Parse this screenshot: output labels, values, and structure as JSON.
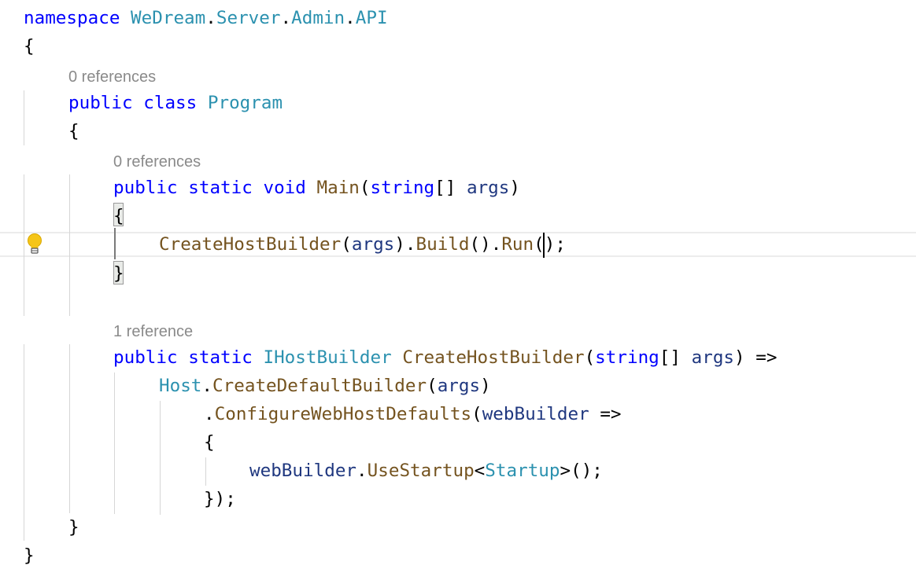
{
  "editor": {
    "code_lens": [
      "0 references",
      "0 references",
      "1 reference"
    ],
    "lines": [
      [
        {
          "t": "namespace",
          "c": "kw"
        },
        {
          "t": " ",
          "c": "pn"
        },
        {
          "t": "WeDream",
          "c": "ty"
        },
        {
          "t": ".",
          "c": "pn"
        },
        {
          "t": "Server",
          "c": "ty"
        },
        {
          "t": ".",
          "c": "pn"
        },
        {
          "t": "Admin",
          "c": "ty"
        },
        {
          "t": ".",
          "c": "pn"
        },
        {
          "t": "API",
          "c": "ty"
        }
      ],
      [
        {
          "t": "{",
          "c": "pn"
        }
      ],
      [
        {
          "t": "public",
          "c": "kw"
        },
        {
          "t": " ",
          "c": "pn"
        },
        {
          "t": "class",
          "c": "kw"
        },
        {
          "t": " ",
          "c": "pn"
        },
        {
          "t": "Program",
          "c": "ty"
        }
      ],
      [
        {
          "t": "{",
          "c": "pn"
        }
      ],
      [
        {
          "t": "public",
          "c": "kw"
        },
        {
          "t": " ",
          "c": "pn"
        },
        {
          "t": "static",
          "c": "kw"
        },
        {
          "t": " ",
          "c": "pn"
        },
        {
          "t": "void",
          "c": "kw"
        },
        {
          "t": " ",
          "c": "pn"
        },
        {
          "t": "Main",
          "c": "mt"
        },
        {
          "t": "(",
          "c": "pn"
        },
        {
          "t": "string",
          "c": "kw"
        },
        {
          "t": "[] ",
          "c": "pn"
        },
        {
          "t": "args",
          "c": "vr"
        },
        {
          "t": ")",
          "c": "pn"
        }
      ],
      [
        {
          "t": "{",
          "c": "pn"
        }
      ],
      [
        {
          "t": "CreateHostBuilder",
          "c": "mt"
        },
        {
          "t": "(",
          "c": "pn"
        },
        {
          "t": "args",
          "c": "vr"
        },
        {
          "t": ").",
          "c": "pn"
        },
        {
          "t": "Build",
          "c": "mt"
        },
        {
          "t": "().",
          "c": "pn"
        },
        {
          "t": "Run",
          "c": "mt"
        },
        {
          "t": "();",
          "c": "pn"
        }
      ],
      [
        {
          "t": "}",
          "c": "pn"
        }
      ],
      [
        {
          "t": "public",
          "c": "kw"
        },
        {
          "t": " ",
          "c": "pn"
        },
        {
          "t": "static",
          "c": "kw"
        },
        {
          "t": " ",
          "c": "pn"
        },
        {
          "t": "IHostBuilder",
          "c": "ty"
        },
        {
          "t": " ",
          "c": "pn"
        },
        {
          "t": "CreateHostBuilder",
          "c": "mt"
        },
        {
          "t": "(",
          "c": "pn"
        },
        {
          "t": "string",
          "c": "kw"
        },
        {
          "t": "[] ",
          "c": "pn"
        },
        {
          "t": "args",
          "c": "vr"
        },
        {
          "t": ") =>",
          "c": "pn"
        }
      ],
      [
        {
          "t": "Host",
          "c": "ty"
        },
        {
          "t": ".",
          "c": "pn"
        },
        {
          "t": "CreateDefaultBuilder",
          "c": "mt"
        },
        {
          "t": "(",
          "c": "pn"
        },
        {
          "t": "args",
          "c": "vr"
        },
        {
          "t": ")",
          "c": "pn"
        }
      ],
      [
        {
          "t": ".",
          "c": "pn"
        },
        {
          "t": "ConfigureWebHostDefaults",
          "c": "mt"
        },
        {
          "t": "(",
          "c": "pn"
        },
        {
          "t": "webBuilder",
          "c": "vr"
        },
        {
          "t": " =>",
          "c": "pn"
        }
      ],
      [
        {
          "t": "{",
          "c": "pn"
        }
      ],
      [
        {
          "t": "webBuilder",
          "c": "vr"
        },
        {
          "t": ".",
          "c": "pn"
        },
        {
          "t": "UseStartup",
          "c": "mt"
        },
        {
          "t": "<",
          "c": "pn"
        },
        {
          "t": "Startup",
          "c": "ty"
        },
        {
          "t": ">();",
          "c": "pn"
        }
      ],
      [
        {
          "t": "});",
          "c": "pn"
        }
      ],
      [
        {
          "t": "}",
          "c": "pn"
        }
      ],
      [
        {
          "t": "}",
          "c": "pn"
        }
      ]
    ],
    "lightbulb_icon": "lightbulb-icon"
  }
}
